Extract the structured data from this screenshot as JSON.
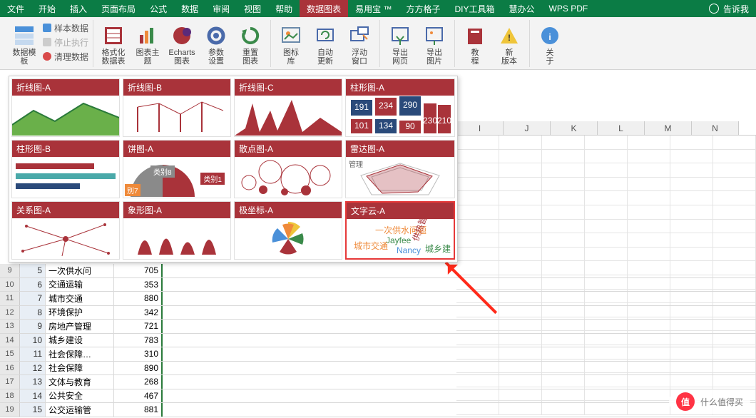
{
  "tabs": {
    "file": "文件",
    "list": [
      "开始",
      "插入",
      "页面布局",
      "公式",
      "数据",
      "审阅",
      "视图",
      "帮助",
      "数据图表",
      "易用宝 ™",
      "方方格子",
      "DIY工具箱",
      "慧办公",
      "WPS PDF"
    ],
    "active": "数据图表",
    "tellme": "告诉我"
  },
  "ribbon": {
    "template": "数据模\n板",
    "mini": [
      "样本数据",
      "停止执行",
      "清理数据"
    ],
    "btns": [
      "格式化\n数据表",
      "图表主\n题",
      "Echarts\n图表",
      "参数\n设置",
      "重置\n图表",
      "图标\n库",
      "自动\n更新",
      "浮动\n窗口",
      "导出\n网页",
      "导出\n图片",
      "教\n程",
      "新\n版本",
      "关\n于"
    ]
  },
  "gallery": [
    {
      "t": "折线图-A"
    },
    {
      "t": "折线图-B"
    },
    {
      "t": "折线图-C"
    },
    {
      "t": "柱形图-A"
    },
    {
      "t": "柱形图-B"
    },
    {
      "t": "饼图-A",
      "l1": "类别8",
      "l2": "类别1",
      "l3": "别7"
    },
    {
      "t": "散点图-A"
    },
    {
      "t": "雷达图-A",
      "mg": "管理"
    },
    {
      "t": "关系图-A"
    },
    {
      "t": "象形图-A"
    },
    {
      "t": "极坐标-A"
    },
    {
      "t": "文字云-A",
      "sel": true
    }
  ],
  "columns": [
    "I",
    "J",
    "K",
    "L",
    "M",
    "N"
  ],
  "rows": [
    {
      "n": "9",
      "a": "5",
      "b": "一次供水问",
      "c": "705"
    },
    {
      "n": "10",
      "a": "6",
      "b": "交通运输",
      "c": "353"
    },
    {
      "n": "11",
      "a": "7",
      "b": "城市交通",
      "c": "880"
    },
    {
      "n": "12",
      "a": "8",
      "b": "环境保护",
      "c": "342"
    },
    {
      "n": "13",
      "a": "9",
      "b": "房地产管理",
      "c": "721"
    },
    {
      "n": "14",
      "a": "10",
      "b": "城乡建设",
      "c": "783"
    },
    {
      "n": "15",
      "a": "11",
      "b": "社会保障…",
      "c": "310"
    },
    {
      "n": "16",
      "a": "12",
      "b": "社会保障",
      "c": "890"
    },
    {
      "n": "17",
      "a": "13",
      "b": "文体与教育",
      "c": "268"
    },
    {
      "n": "18",
      "a": "14",
      "b": "公共安全",
      "c": "467"
    },
    {
      "n": "19",
      "a": "15",
      "b": "公交运输管",
      "c": "881"
    }
  ],
  "wm": {
    "badge": "值",
    "text": "什么值得买"
  },
  "bar4": {
    "v": [
      "191",
      "234",
      "290",
      "101",
      "134",
      "90",
      "230",
      "210"
    ]
  }
}
